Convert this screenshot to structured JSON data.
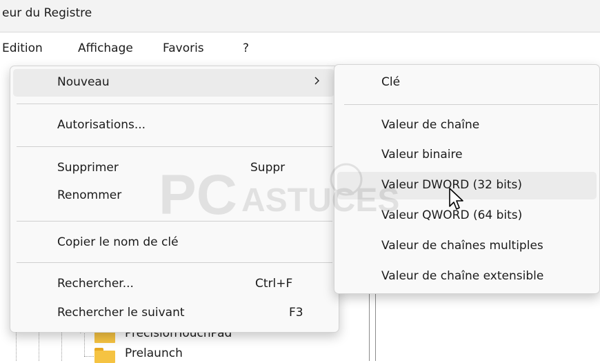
{
  "window": {
    "title": "eur du Registre"
  },
  "menubar": {
    "items": [
      "Edition",
      "Affichage",
      "Favoris",
      "?"
    ]
  },
  "context_menu": {
    "items": [
      {
        "label": "Nouveau",
        "shortcut": "",
        "has_submenu": true,
        "highlighted": true
      },
      {
        "label": "Autorisations...",
        "shortcut": ""
      },
      {
        "label": "Supprimer",
        "shortcut": "Suppr"
      },
      {
        "label": "Renommer",
        "shortcut": ""
      },
      {
        "label": "Copier le nom de clé",
        "shortcut": ""
      },
      {
        "label": "Rechercher...",
        "shortcut": "Ctrl+F"
      },
      {
        "label": "Rechercher le suivant",
        "shortcut": "F3"
      }
    ]
  },
  "submenu": {
    "items": [
      {
        "label": "Clé"
      },
      {
        "label": "Valeur de chaîne"
      },
      {
        "label": "Valeur binaire"
      },
      {
        "label": "Valeur DWORD (32 bits)",
        "highlighted": true
      },
      {
        "label": "Valeur QWORD (64 bits)"
      },
      {
        "label": "Valeur de chaînes multiples"
      },
      {
        "label": "Valeur de chaîne extensible"
      }
    ]
  },
  "tree": {
    "items": [
      {
        "label": "PrecisionTouchPad",
        "expandable": true
      },
      {
        "label": "Prelaunch",
        "expandable": false
      }
    ]
  },
  "watermark": {
    "text": "PC ASTUCES"
  },
  "colors": {
    "menu_background": "#f9f9f9",
    "highlight": "#ebebeb",
    "folder": "#f5c342"
  }
}
